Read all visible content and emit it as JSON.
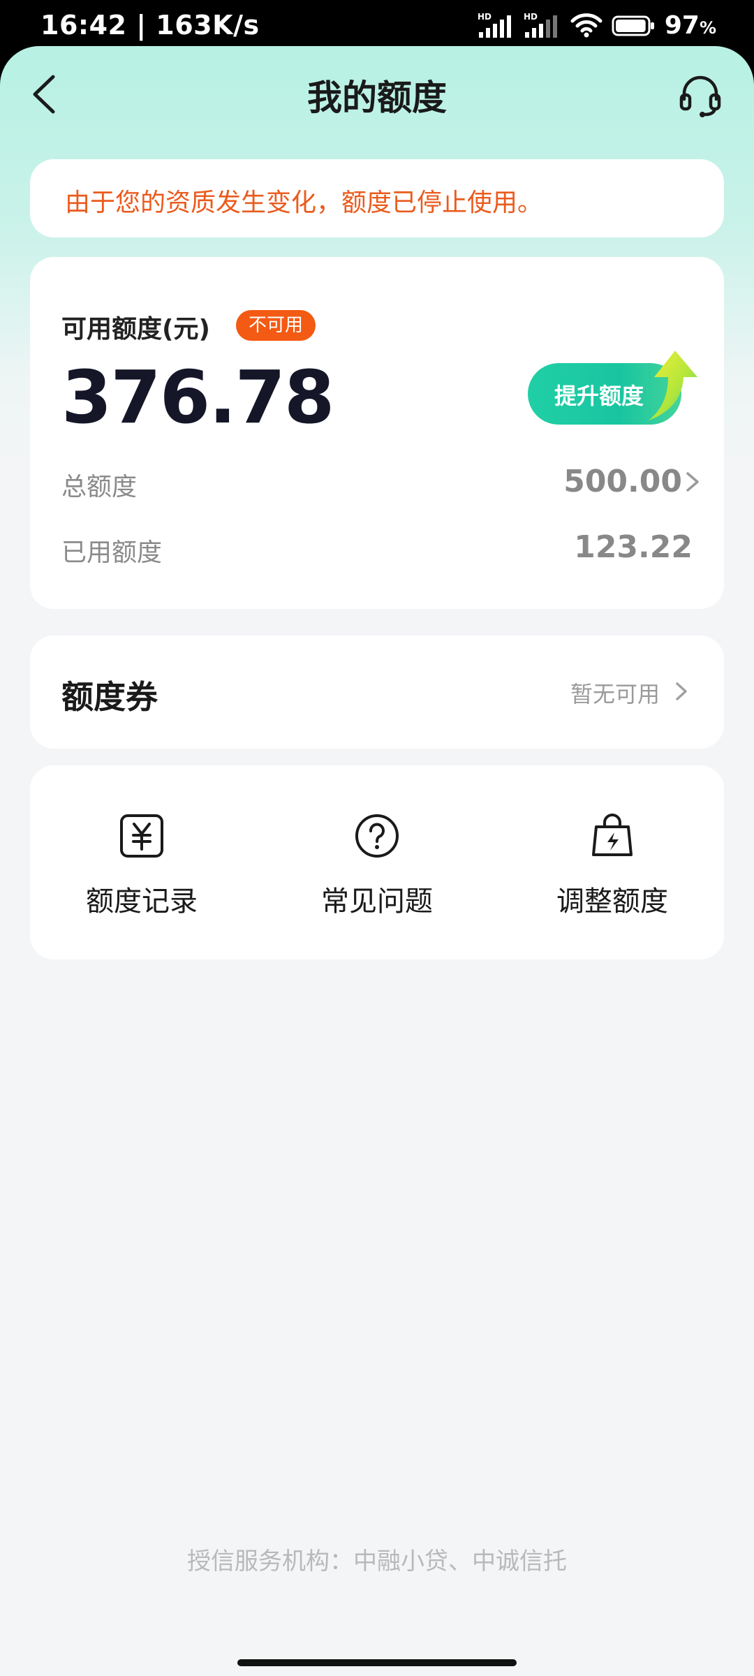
{
  "status_bar": {
    "time_speed": "16:42 | 163K/s",
    "battery_percent": "97",
    "battery_unit": "%",
    "network_labels": [
      "HD",
      "HD"
    ],
    "battery_level": 0.97
  },
  "nav": {
    "title": "我的额度",
    "back_icon": "chevron-left-icon",
    "service_icon": "headset-icon"
  },
  "notice": {
    "text": "由于您的资质发生变化，额度已停止使用。"
  },
  "quota": {
    "label": "可用额度(元)",
    "badge": "不可用",
    "amount": "376.78",
    "raise_button": "提升额度",
    "total_label": "总额度",
    "total_value": "500.00",
    "used_label": "已用额度",
    "used_value": "123.22"
  },
  "coupon": {
    "title": "额度券",
    "status": "暂无可用"
  },
  "actions": [
    {
      "label": "额度记录",
      "icon": "yuan-record-icon"
    },
    {
      "label": "常见问题",
      "icon": "question-circle-icon"
    },
    {
      "label": "调整额度",
      "icon": "bag-lightning-icon"
    }
  ],
  "footer": {
    "text": "授信服务机构：中融小贷、中诚信托"
  },
  "colors": {
    "accent_green": "#1fcba3",
    "warning_orange": "#ea5b1d",
    "badge_orange": "#f35a13"
  }
}
